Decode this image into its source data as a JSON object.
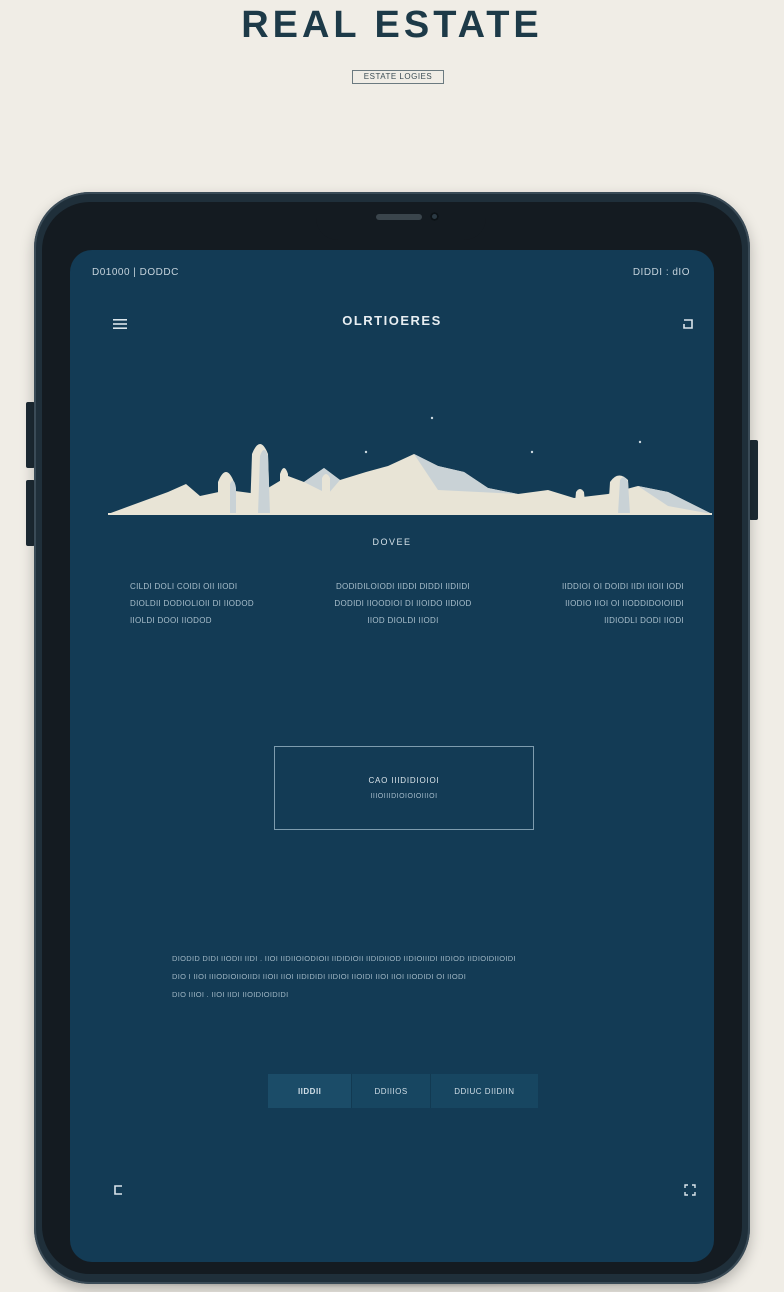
{
  "header": {
    "title": "REAL ESTATE",
    "tagline": "ESTATE LOGIES"
  },
  "device": {
    "status_bar": {
      "left": "D01000 | DODDC",
      "right": "DIDDI  : dIO"
    },
    "nav": {
      "title": "OLRTIOERES",
      "menu_icon": "hamburger-menu-icon",
      "action_icon": "corner-arrow-icon"
    },
    "hero": {
      "illustration": "mountain-skyline-illustration",
      "colors": {
        "snow": "#e8e4d6",
        "shadow": "#c9d2d6",
        "screen_bg": "#133b55"
      }
    },
    "section_label": "DOVEE",
    "features": [
      {
        "lines": [
          "CILDI  DOLI  COIDI  OII  IIODI",
          "DIOLDII  DODIOLIOII  DI  IIODOD",
          "IIOLDI  DOOI  IIODOD"
        ]
      },
      {
        "lines": [
          "DODIDILOIODI  IIDDI  DIDDI  IIDIIDI",
          "DODIDI  IIOODIOI  DI  IIOIDO  IIDIOD",
          "IIOD  DIOLDI  IIODI"
        ]
      },
      {
        "lines": [
          "IIDDIOI  OI  DOIDI  IIDI  IIOII  IODI",
          "IIODIO  IIOI  OI  IIODDIDOIOIIDI",
          "IIDIODLI  DODI  IIODI"
        ]
      }
    ],
    "cta": {
      "title": "CAO  IIIDIDIOIOI",
      "subtitle": "IIIOIIIDIOIOIOIIIOI"
    },
    "paragraph": [
      "DIODID  DIDI  IIODII  IIDI  .  IIOI  IIDIIOIODIOII  IIDIDIOII  IIDIDIIOD  IIDIOIIIDI  IIDIOD  IIDIOIDIIOIDI",
      "DIO I  IIOI  IIIODIOIIOIIDI  IIOII  IIOI  IIDIDIDI  IIDIOI  IIOIDI  IIOI  IIOI  IIODIDI  OI  IIODI",
      "DIO  IIIOI  .  IIOI  IIDI  IIOIDIOIDIDI"
    ],
    "tabs": [
      {
        "label": "IIDDII",
        "active": true
      },
      {
        "label": "DDIIIOS",
        "active": false
      },
      {
        "label": "DDIUC  DIIDIIN",
        "active": false
      }
    ],
    "bottom_left_icon": "back-arrow-icon",
    "bottom_right_icon": "expand-icon"
  }
}
